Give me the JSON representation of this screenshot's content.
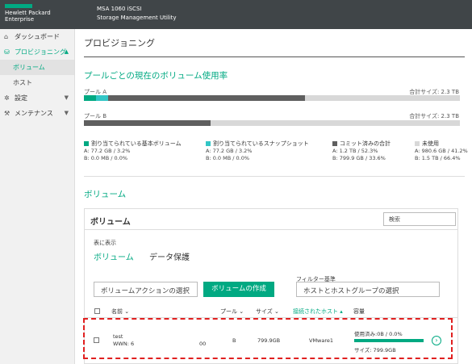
{
  "header": {
    "brand_line1": "Hewlett Packard",
    "brand_line2": "Enterprise",
    "product_line1": "MSA 1060 iSCSI",
    "product_line2": "Storage Management Utility"
  },
  "sidebar": {
    "items": [
      {
        "label": "ダッシュボード",
        "icon": "home-icon"
      },
      {
        "label": "プロビジョニング",
        "icon": "database-icon"
      },
      {
        "label": "ボリューム"
      },
      {
        "label": "ホスト"
      },
      {
        "label": "設定",
        "icon": "gear-icon"
      },
      {
        "label": "メンテナンス",
        "icon": "wrench-icon"
      }
    ]
  },
  "main": {
    "page_title": "プロビジョニング",
    "pool_section_title": "プールごとの現在のボリューム使用率",
    "pools": [
      {
        "name": "プール A",
        "size": "合計サイズ: 2.3 TB"
      },
      {
        "name": "プール B",
        "size": "合計サイズ: 2.3 TB"
      }
    ],
    "legend": [
      {
        "label": "割り当てられている基本ボリューム",
        "a": "A: 77.2 GB / 3.2%",
        "b": "B: 0.0 MB / 0.0%",
        "color": "#01a982"
      },
      {
        "label": "割り当てられているスナップショット",
        "a": "A: 77.2 GB / 3.2%",
        "b": "B: 0.0 MB / 0.0%",
        "color": "#32c6c6"
      },
      {
        "label": "コミット済みの合計",
        "a": "A: 1.2 TB / 52.3%",
        "b": "B: 799.9 GB / 33.6%",
        "color": "#5f5f5f"
      },
      {
        "label": "未使用",
        "a": "A: 980.6 GB / 41.2%",
        "b": "B: 1.5 TB / 66.4%",
        "color": "#d8d8d8"
      }
    ],
    "volume_section_title": "ボリューム"
  },
  "panel": {
    "title": "ボリューム",
    "search_placeholder": "検索",
    "show_label": "表に表示",
    "tab_volumes": "ボリューム",
    "tab_data_protection": "データ保護",
    "filter_label": "フィルター基準",
    "action_select": "ボリュームアクションの選択",
    "create_button": "ボリュームの作成",
    "host_filter_select": "ホストとホストグループの選択",
    "columns": {
      "name": "名前",
      "pool": "プール",
      "size": "サイズ",
      "connected_hosts": "接続されたホスト",
      "capacity": "容量"
    },
    "rows": [
      {
        "name": "test",
        "wwn": "WWN: 6",
        "wwn_tail": "00",
        "pool": "B",
        "size": "799.9GB",
        "host": "VMware1",
        "used": "使用済み:0B / 0.0%",
        "size_label": "サイズ: 799.9GB"
      }
    ]
  },
  "chart_data": {
    "type": "bar",
    "categories": [
      "プール A",
      "プール B"
    ],
    "series": [
      {
        "name": "割り当てられている基本ボリューム",
        "values": [
          3.2,
          0.0
        ]
      },
      {
        "name": "割り当てられているスナップショット",
        "values": [
          3.2,
          0.0
        ]
      },
      {
        "name": "コミット済みの合計",
        "values": [
          52.3,
          33.6
        ]
      },
      {
        "name": "未使用",
        "values": [
          41.2,
          66.4
        ]
      }
    ],
    "unit": "%"
  }
}
